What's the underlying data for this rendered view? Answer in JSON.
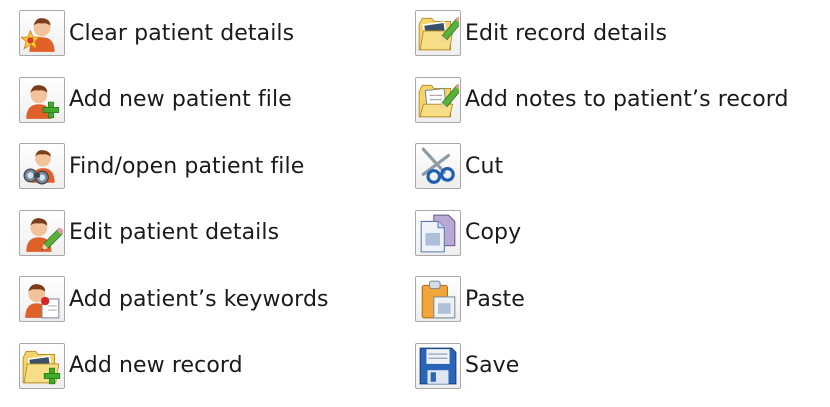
{
  "legend": {
    "left": [
      {
        "label": "Clear patient details",
        "icon": "clear-patient-icon"
      },
      {
        "label": "Add new patient file",
        "icon": "add-patient-icon"
      },
      {
        "label": "Find/open patient file",
        "icon": "find-patient-icon"
      },
      {
        "label": "Edit patient details",
        "icon": "edit-patient-icon"
      },
      {
        "label": "Add patient’s keywords",
        "icon": "patient-keywords-icon"
      },
      {
        "label": "Add new record",
        "icon": "add-record-icon"
      }
    ],
    "right": [
      {
        "label": "Edit record details",
        "icon": "edit-record-icon"
      },
      {
        "label": "Add notes to patient’s record",
        "icon": "add-notes-icon"
      },
      {
        "label": "Cut",
        "icon": "scissors-icon"
      },
      {
        "label": "Copy",
        "icon": "copy-icon"
      },
      {
        "label": "Paste",
        "icon": "clipboard-icon"
      },
      {
        "label": "Save",
        "icon": "floppy-disk-icon"
      }
    ]
  },
  "colors": {
    "person_skin": "#f2c39a",
    "person_shirt": "#e0602a",
    "folder": "#f3d36a",
    "plus_green": "#3faa2c",
    "button_border": "#a8a8a8"
  }
}
